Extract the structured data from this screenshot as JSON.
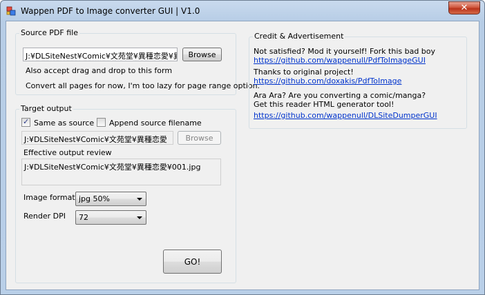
{
  "window": {
    "title": "Wappen PDF to Image converter GUI | V1.0",
    "close_label": "✕"
  },
  "source": {
    "group_title": "Source PDF file",
    "path": "J:¥DLSiteNest¥Comic¥文苑堂¥異種恋愛¥異",
    "browse_label": "Browse",
    "drag_hint": "Also accept drag and drop to this form",
    "pages_hint": "Convert all pages for now, I'm too lazy for page range option."
  },
  "target": {
    "group_title": "Target output",
    "same_as_source_label": "Same as source",
    "same_as_source_checked": true,
    "append_filename_label": "Append source filename",
    "append_filename_checked": false,
    "path": "J:¥DLSiteNest¥Comic¥文苑堂¥異種恋愛",
    "browse_label": "Browse",
    "review_label": "Effective output review",
    "review_value": "J:¥DLSiteNest¥Comic¥文苑堂¥異種恋愛¥001.jpg",
    "format_label": "Image format",
    "format_value": "jpg 50%",
    "dpi_label": "Render DPI",
    "dpi_value": "72",
    "go_label": "GO!"
  },
  "credit": {
    "group_title": "Credit & Advertisement",
    "line1": "Not satisfied? Mod it yourself! Fork this bad boy",
    "link1": "https://github.com/wappenull/PdfToImageGUI",
    "line2": "Thanks to original project!",
    "link2": "https://github.com/doxakis/PdfToImage",
    "line3": "Ara Ara? Are you converting a comic/manga?",
    "line4": "Get this reader HTML generator tool!",
    "link3": "https://github.com/wappenull/DLSiteDumperGUI"
  }
}
